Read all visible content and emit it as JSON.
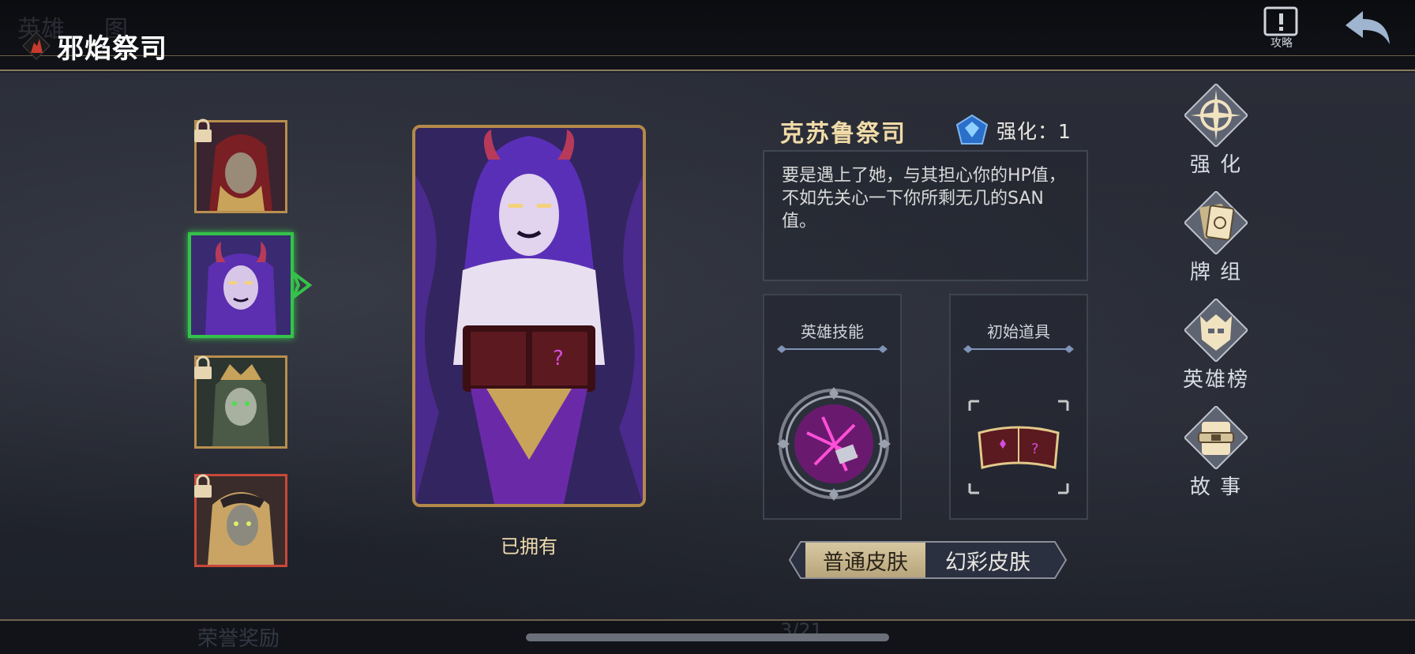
{
  "header": {
    "title": "邪焰祭司",
    "ghost_label_1": "英雄",
    "ghost_label_2": "图",
    "guide_label": "攻略"
  },
  "heroes": [
    {
      "name": "hero-1",
      "locked": true,
      "frame": "gold"
    },
    {
      "name": "hero-2",
      "locked": false,
      "frame": "green",
      "selected": true
    },
    {
      "name": "hero-3",
      "locked": true,
      "frame": "gold"
    },
    {
      "name": "hero-4",
      "locked": true,
      "frame": "red"
    }
  ],
  "portrait": {
    "status": "已拥有"
  },
  "detail": {
    "hero_name": "克苏鲁祭司",
    "upgrade_label": "强化：1",
    "description": "要是遇上了她，与其担心你的HP值，不如先关心一下你所剩无几的SAN值。",
    "skill_panel_title": "英雄技能",
    "item_panel_title": "初始道具"
  },
  "skins": {
    "normal": "普通皮肤",
    "color": "幻彩皮肤",
    "active": "normal"
  },
  "menu": [
    {
      "label": "强 化",
      "icon": "compass-icon"
    },
    {
      "label": "牌 组",
      "icon": "cards-icon"
    },
    {
      "label": "英雄榜",
      "icon": "helmet-icon"
    },
    {
      "label": "故 事",
      "icon": "scroll-icon"
    }
  ],
  "footer": {
    "ghost_reward": "荣誉奖励",
    "ghost_page": "3/21"
  },
  "colors": {
    "accent_gold": "#b3894a",
    "selected_green": "#35c24a",
    "locked_red": "#c9483a"
  }
}
